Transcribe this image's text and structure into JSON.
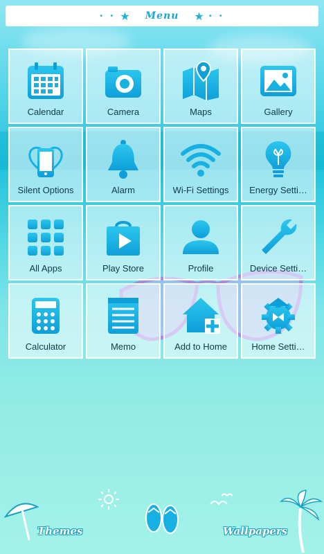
{
  "menu": {
    "title": "Menu"
  },
  "tiles": [
    {
      "label": "Calendar",
      "icon": "calendar-icon"
    },
    {
      "label": "Camera",
      "icon": "camera-icon"
    },
    {
      "label": "Maps",
      "icon": "map-icon"
    },
    {
      "label": "Gallery",
      "icon": "gallery-icon"
    },
    {
      "label": "Silent Options",
      "icon": "silent-phone-icon"
    },
    {
      "label": "Alarm",
      "icon": "bell-icon"
    },
    {
      "label": "Wi-Fi Settings",
      "icon": "wifi-icon"
    },
    {
      "label": "Energy Setti…",
      "icon": "lightbulb-icon"
    },
    {
      "label": "All Apps",
      "icon": "apps-grid-icon"
    },
    {
      "label": "Play Store",
      "icon": "play-store-icon"
    },
    {
      "label": "Profile",
      "icon": "person-icon"
    },
    {
      "label": "Device Setti…",
      "icon": "wrench-icon"
    },
    {
      "label": "Calculator",
      "icon": "calculator-icon"
    },
    {
      "label": "Memo",
      "icon": "memo-icon"
    },
    {
      "label": "Add to Home",
      "icon": "add-home-icon"
    },
    {
      "label": "Home Setti…",
      "icon": "home-gear-icon"
    }
  ],
  "bottom": {
    "themes_label": "Themes",
    "wallpapers_label": "Wallpapers"
  },
  "colors": {
    "accent": "#16b2e0",
    "tile_bg": "#ffffff",
    "label": "#0e3a4a"
  }
}
